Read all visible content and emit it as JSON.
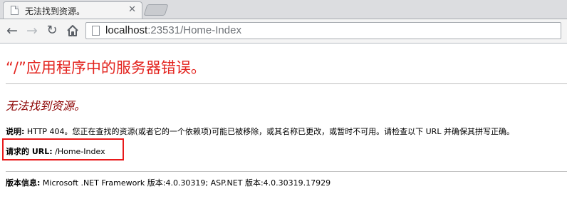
{
  "tab": {
    "title": "无法找到资源。"
  },
  "address_bar": {
    "host": "localhost",
    "rest": ":23531/Home-Index"
  },
  "page": {
    "heading": "“/”应用程序中的服务器错误。",
    "subheading": "无法找到资源。",
    "description_label": "说明:",
    "description_text": " HTTP 404。您正在查找的资源(或者它的一个依赖项)可能已被移除，或其名称已更改，或暂时不可用。请检查以下 URL 并确保其拼写正确。",
    "requested_url_label": "请求的 URL:",
    "requested_url_value": " /Home-Index",
    "version_label": "版本信息:",
    "version_text": " Microsoft .NET Framework 版本:4.0.30319; ASP.NET 版本:4.0.30319.17929"
  },
  "colors": {
    "heading": "#e3231e",
    "subheading": "#8b0000",
    "highlight_box": "#e8191a"
  },
  "icons": [
    "page-favicon-icon",
    "close-icon",
    "back-arrow-icon",
    "forward-arrow-icon",
    "reload-icon",
    "home-icon",
    "page-icon"
  ]
}
